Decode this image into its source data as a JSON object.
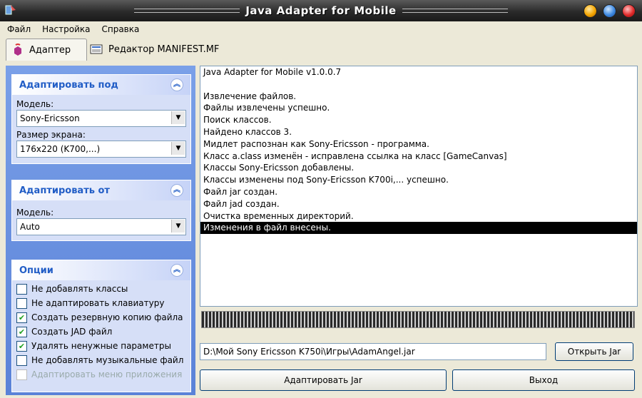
{
  "window": {
    "title": "Java Adapter for Mobile"
  },
  "menu": [
    "Файл",
    "Настройка",
    "Справка"
  ],
  "tabs": [
    {
      "label": "Адаптер",
      "icon": "adapter-icon",
      "active": true
    },
    {
      "label": "Редактор MANIFEST.MF",
      "icon": "manifest-icon",
      "active": false
    }
  ],
  "sidebar": {
    "adapt_to": {
      "header": "Адаптировать под",
      "model_label": "Модель:",
      "model_value": "Sony-Ericsson",
      "screen_label": "Размер экрана:",
      "screen_value": "176x220 (K700,...)"
    },
    "adapt_from": {
      "header": "Адаптировать от",
      "model_label": "Модель:",
      "model_value": "Auto"
    },
    "options": {
      "header": "Опции",
      "items": [
        {
          "label": "Не добавлять классы",
          "checked": false,
          "enabled": true
        },
        {
          "label": "Не адаптировать клавиатуру",
          "checked": false,
          "enabled": true
        },
        {
          "label": "Создать резервную копию файла",
          "checked": true,
          "enabled": true
        },
        {
          "label": "Создать JAD файл",
          "checked": true,
          "enabled": true
        },
        {
          "label": "Удалять ненужные параметры",
          "checked": true,
          "enabled": true
        },
        {
          "label": "Не добавлять музыкальные файл",
          "checked": false,
          "enabled": true
        },
        {
          "label": "Адаптировать меню приложения",
          "checked": false,
          "enabled": false
        }
      ]
    }
  },
  "log": {
    "lines": [
      "Java Adapter for Mobile v1.0.0.7",
      "",
      "Извлечение файлов.",
      "Файлы извлечены успешно.",
      "Поиск классов.",
      "Найдено классов 3.",
      "Мидлет распознан как Sony-Ericsson - программа.",
      "Класс a.class изменён - исправлена ссылка на класс [GameCanvas]",
      "Классы Sony-Ericsson добавлены.",
      "Классы изменены под Sony-Ericsson K700i,... успешно.",
      "Файл jar создан.",
      "Файл jad создан.",
      "Очистка временных директорий.",
      "Изменения в файл внесены."
    ],
    "selected_index": 13
  },
  "path": {
    "value": "D:\\Мой Sony Ericsson K750i\\Игры\\AdamAngel.jar"
  },
  "buttons": {
    "open": "Открыть Jar",
    "adapt": "Адаптировать Jar",
    "exit": "Выход"
  },
  "colors": {
    "sidebar": "#6a8fe0",
    "group_header_text": "#215dc6",
    "selection": "#000000"
  }
}
